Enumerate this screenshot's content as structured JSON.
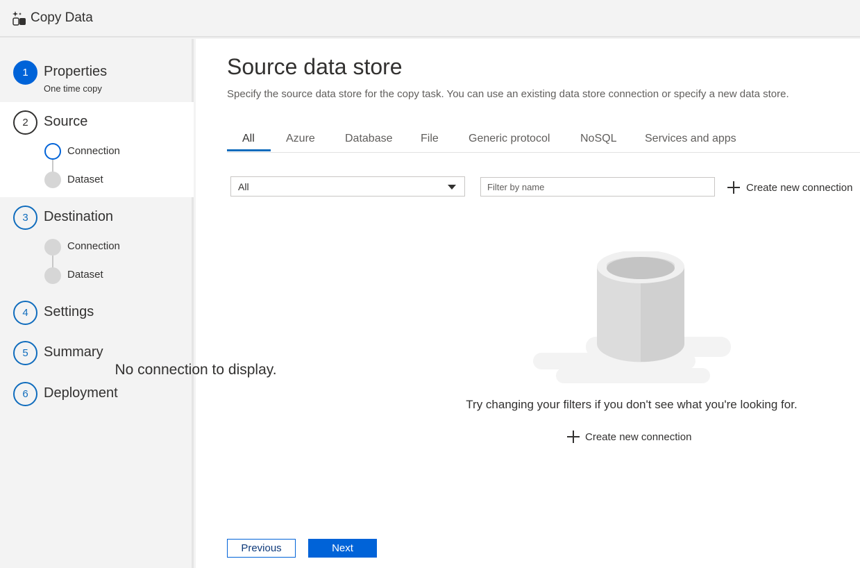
{
  "header": {
    "title": "Copy Data",
    "icon": "copy-data-icon"
  },
  "sidebar": {
    "steps": [
      {
        "number": "1",
        "title": "Properties",
        "subtitle": "One time copy"
      },
      {
        "number": "2",
        "title": "Source",
        "substeps": [
          "Connection",
          "Dataset"
        ]
      },
      {
        "number": "3",
        "title": "Destination",
        "substeps": [
          "Connection",
          "Dataset"
        ]
      },
      {
        "number": "4",
        "title": "Settings"
      },
      {
        "number": "5",
        "title": "Summary"
      },
      {
        "number": "6",
        "title": "Deployment"
      }
    ]
  },
  "main": {
    "title": "Source data store",
    "description": "Specify the source data store for the copy task. You can use an existing data store connection or specify a new data store.",
    "tabs": [
      "All",
      "Azure",
      "Database",
      "File",
      "Generic protocol",
      "NoSQL",
      "Services and apps"
    ],
    "selected_tab": "All",
    "type_filter": {
      "value": "All"
    },
    "name_filter": {
      "placeholder": "Filter by name",
      "value": ""
    },
    "create_new_connection_label": "Create new connection",
    "empty_state": {
      "title": "No connection to display.",
      "hint": "Try changing your filters if you don't see what you're looking for.",
      "action_label": "Create new connection"
    },
    "buttons": {
      "previous": "Previous",
      "next": "Next"
    }
  },
  "colors": {
    "accent": "#0063d8",
    "active_step_bg": "#ffffff",
    "sidebar_bg": "#f3f3f3"
  }
}
